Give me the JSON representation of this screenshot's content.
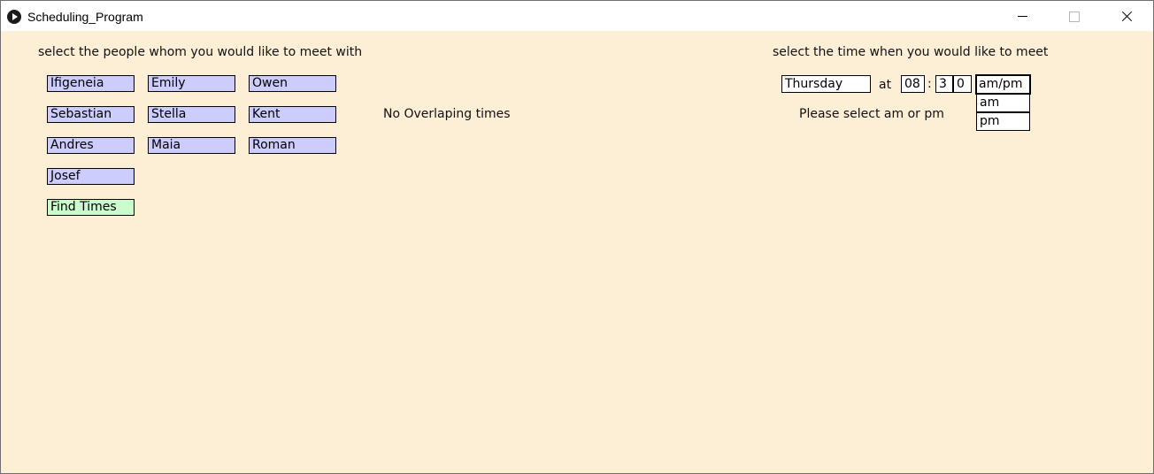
{
  "window": {
    "title": "Scheduling_Program"
  },
  "people_section": {
    "heading": "select the people whom you would like to meet with",
    "people": [
      "Ifigeneia",
      "Emily",
      "Owen",
      "Sebastian",
      "Stella",
      "Kent",
      "Andres",
      "Maia",
      "Roman",
      "Josef"
    ],
    "find_button_label": "Find Times"
  },
  "result_message": "No Overlaping times",
  "time_section": {
    "heading": "select the time when you would like to meet",
    "day_value": "Thursday",
    "at_label": "at",
    "hour_value": "08",
    "colon": ":",
    "minute_tens": "3",
    "minute_ones": "0",
    "ampm_value": "am/pm",
    "ampm_options": [
      "am",
      "pm"
    ],
    "prompt": "Please select am or pm"
  },
  "colors": {
    "background": "#fdeed6",
    "person_button": "#cccdfd",
    "find_button": "#cbfdcc"
  }
}
